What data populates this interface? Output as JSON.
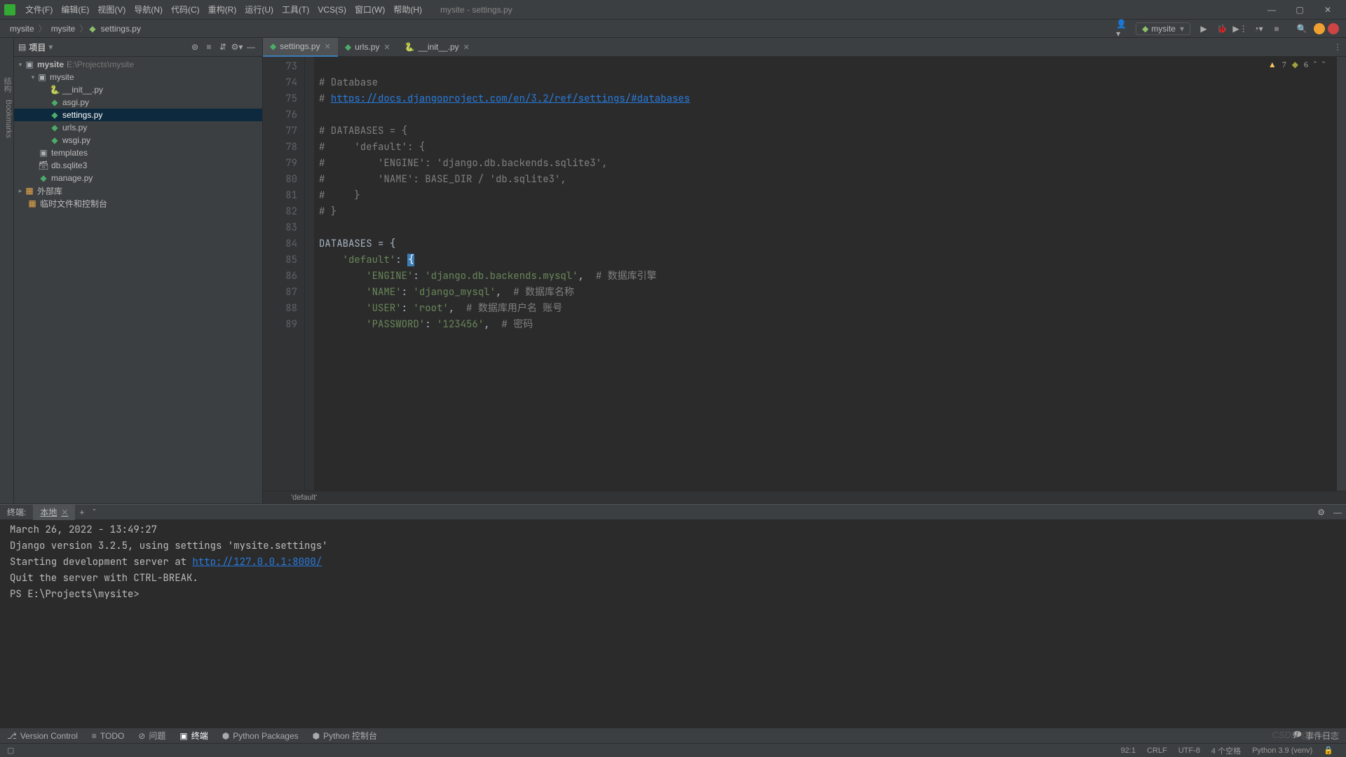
{
  "titlebar": {
    "menus": [
      "文件(F)",
      "编辑(E)",
      "视图(V)",
      "导航(N)",
      "代码(C)",
      "重构(R)",
      "运行(U)",
      "工具(T)",
      "VCS(S)",
      "窗口(W)",
      "帮助(H)"
    ],
    "title": "mysite - settings.py"
  },
  "breadcrumb": {
    "items": [
      "mysite",
      "mysite",
      "settings.py"
    ]
  },
  "run": {
    "config": "mysite"
  },
  "project": {
    "title": "项目",
    "root": {
      "name": "mysite",
      "path": "E:\\Projects\\mysite"
    },
    "mysite_pkg": {
      "name": "mysite"
    },
    "files": [
      "__init__.py",
      "asgi.py",
      "settings.py",
      "urls.py",
      "wsgi.py"
    ],
    "templates": "templates",
    "dbfile": "db.sqlite3",
    "manage": "manage.py",
    "ext_libs": "外部库",
    "scratch": "临时文件和控制台"
  },
  "tabs": [
    {
      "name": "settings.py",
      "active": true,
      "kind": "dj"
    },
    {
      "name": "urls.py",
      "active": false,
      "kind": "dj"
    },
    {
      "name": "__init__.py",
      "active": false,
      "kind": "py"
    }
  ],
  "inspections": {
    "warn": 7,
    "weak": 6
  },
  "gutter_start": 73,
  "code_lines": [
    {
      "t": "",
      "cls": ""
    },
    {
      "t": "# Database",
      "cls": "c"
    },
    {
      "t": "# ",
      "cls": "c",
      "link": "https://docs.djangoproject.com/en/3.2/ref/settings/#databases"
    },
    {
      "t": "",
      "cls": ""
    },
    {
      "t": "# DATABASES = {",
      "cls": "c"
    },
    {
      "t": "#     'default': {",
      "cls": "c"
    },
    {
      "t": "#         'ENGINE': 'django.db.backends.sqlite3',",
      "cls": "c"
    },
    {
      "t": "#         'NAME': BASE_DIR / 'db.sqlite3',",
      "cls": "c"
    },
    {
      "t": "#     }",
      "cls": "c"
    },
    {
      "t": "# }",
      "cls": "c"
    },
    {
      "t": "",
      "cls": ""
    },
    {
      "t": "DATABASES = {",
      "cls": "code",
      "seg": [
        {
          "t": "DATABASES = {",
          "c": ""
        }
      ]
    },
    {
      "t": "    'default': {",
      "cls": "code",
      "seg": [
        {
          "t": "    ",
          "c": ""
        },
        {
          "t": "'default'",
          "c": "s"
        },
        {
          "t": ": ",
          "c": ""
        },
        {
          "t": "{",
          "c": "cursor"
        }
      ]
    },
    {
      "t": "        'ENGINE': 'django.db.backends.mysql',  # 数据库引擎",
      "cls": "code",
      "seg": [
        {
          "t": "        ",
          "c": ""
        },
        {
          "t": "'ENGINE'",
          "c": "s"
        },
        {
          "t": ": ",
          "c": ""
        },
        {
          "t": "'django.db.backends.mysql'",
          "c": "s"
        },
        {
          "t": ",  ",
          "c": ""
        },
        {
          "t": "# 数据库引擎",
          "c": "c"
        }
      ]
    },
    {
      "t": "        'NAME': 'django_mysql',  # 数据库名称",
      "cls": "code",
      "seg": [
        {
          "t": "        ",
          "c": ""
        },
        {
          "t": "'NAME'",
          "c": "s"
        },
        {
          "t": ": ",
          "c": ""
        },
        {
          "t": "'django_mysql'",
          "c": "s"
        },
        {
          "t": ",  ",
          "c": ""
        },
        {
          "t": "# 数据库名称",
          "c": "c"
        }
      ]
    },
    {
      "t": "        'USER': 'root',  # 数据库用户名 账号",
      "cls": "code",
      "seg": [
        {
          "t": "        ",
          "c": ""
        },
        {
          "t": "'USER'",
          "c": "s"
        },
        {
          "t": ": ",
          "c": ""
        },
        {
          "t": "'root'",
          "c": "s"
        },
        {
          "t": ",  ",
          "c": ""
        },
        {
          "t": "# 数据库用户名 账号",
          "c": "c"
        }
      ]
    },
    {
      "t": "        'PASSWORD': '123456',  # 密码",
      "cls": "code",
      "seg": [
        {
          "t": "        ",
          "c": ""
        },
        {
          "t": "'PASSWORD'",
          "c": "s"
        },
        {
          "t": ": ",
          "c": ""
        },
        {
          "t": "'123456'",
          "c": "s"
        },
        {
          "t": ",  ",
          "c": ""
        },
        {
          "t": "# 密码",
          "c": "c"
        }
      ]
    }
  ],
  "breadcrumb_bottom": "'default'",
  "terminal": {
    "label": "终端:",
    "tab": "本地",
    "lines": [
      {
        "t": "March 26, 2022 - 13:49:27"
      },
      {
        "t": "Django version 3.2.5, using settings 'mysite.settings'"
      },
      {
        "pre": "Starting development server at ",
        "link": "http://127.0.0.1:8000/"
      },
      {
        "t": "Quit the server with CTRL-BREAK."
      },
      {
        "t": "PS E:\\Projects\\mysite>"
      }
    ]
  },
  "toolwindows": [
    "Version Control",
    "TODO",
    "问题",
    "终端",
    "Python Packages",
    "Python 控制台"
  ],
  "watermark": "CSDN @lehocat",
  "statusbar": {
    "pos": "92:1",
    "sep": "CRLF",
    "enc": "UTF-8",
    "indent": "4 个空格",
    "py": "Python 3.9 (venv)",
    "lock": "🔒"
  },
  "event_log": "事件日志",
  "rails": [
    "结构",
    "Bookmarks"
  ]
}
